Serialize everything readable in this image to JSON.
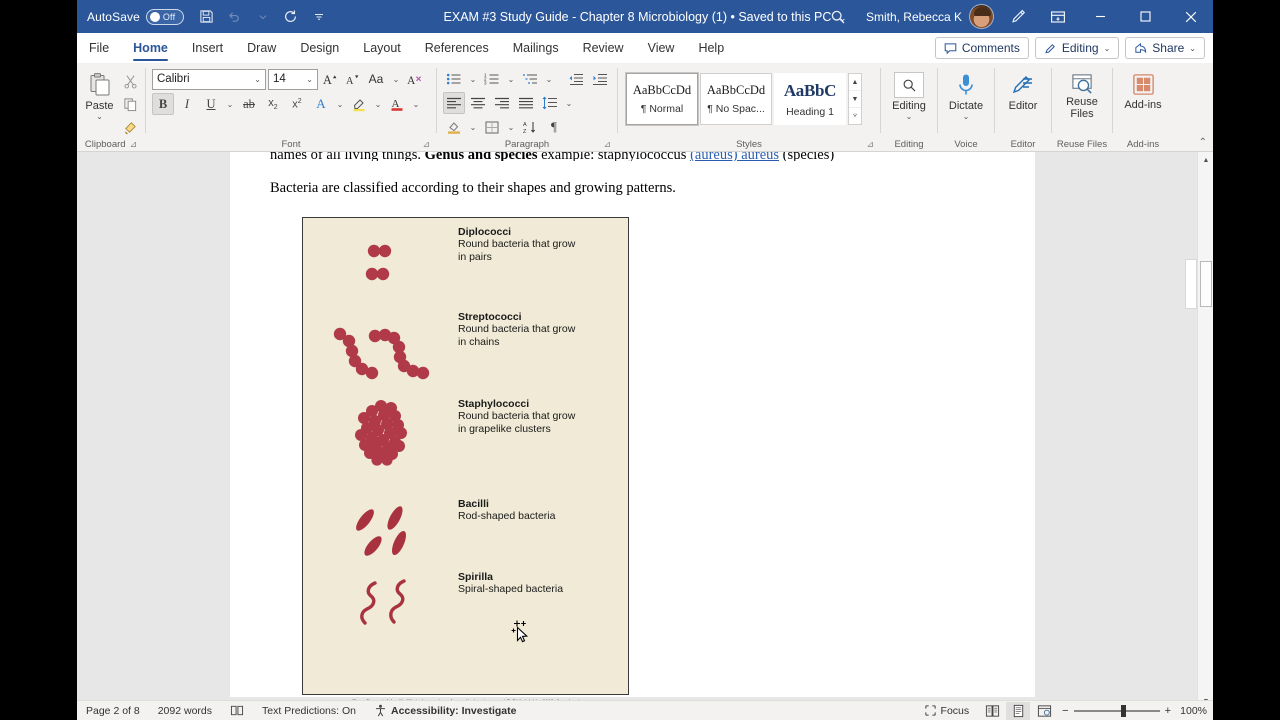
{
  "titlebar": {
    "autosave_label": "AutoSave",
    "autosave_state": "Off",
    "document_title": "EXAM #3 Study Guide - Chapter 8 Microbiology (1) • Saved to this PC",
    "account_name": "Smith, Rebecca K",
    "quick_access": [
      "save-icon",
      "undo-icon",
      "redo-icon",
      "customize-qat-icon"
    ],
    "right_icons": [
      "search-icon",
      "pen-icon",
      "ribbon-display-icon"
    ],
    "window_buttons": [
      "minimize",
      "maximize",
      "close"
    ],
    "accent_color": "#2b579a"
  },
  "tabs": [
    {
      "label": "File",
      "active": false
    },
    {
      "label": "Home",
      "active": true
    },
    {
      "label": "Insert",
      "active": false
    },
    {
      "label": "Draw",
      "active": false
    },
    {
      "label": "Design",
      "active": false
    },
    {
      "label": "Layout",
      "active": false
    },
    {
      "label": "References",
      "active": false
    },
    {
      "label": "Mailings",
      "active": false
    },
    {
      "label": "Review",
      "active": false
    },
    {
      "label": "View",
      "active": false
    },
    {
      "label": "Help",
      "active": false
    }
  ],
  "tabbar_actions": {
    "comments": "Comments",
    "editing": "Editing",
    "share": "Share"
  },
  "ribbon": {
    "clipboard": {
      "label": "Clipboard",
      "paste_label": "Paste",
      "buttons": [
        "cut-icon",
        "copy-icon",
        "format-painter-icon"
      ]
    },
    "font": {
      "label": "Font",
      "font_name": "Calibri",
      "font_size": "14",
      "buttons": [
        "grow-font-icon",
        "shrink-font-icon",
        "change-case-icon",
        "clear-formatting-icon",
        "bold-icon",
        "italic-icon",
        "underline-icon",
        "strikethrough-icon",
        "subscript-icon",
        "superscript-icon",
        "text-effects-icon",
        "text-highlight-icon",
        "font-color-icon"
      ]
    },
    "paragraph": {
      "label": "Paragraph",
      "buttons": [
        "bullets-icon",
        "numbering-icon",
        "multilevel-list-icon",
        "decrease-indent-icon",
        "increase-indent-icon",
        "align-left-icon",
        "align-center-icon",
        "align-right-icon",
        "justify-icon",
        "line-spacing-icon",
        "shading-icon",
        "borders-icon",
        "sort-icon",
        "show-marks-icon"
      ]
    },
    "styles": {
      "label": "Styles",
      "items": [
        {
          "sample": "AaBbCcDd",
          "name": "¶ Normal",
          "selected": true
        },
        {
          "sample": "AaBbCcDd",
          "name": "¶ No Spac...",
          "selected": false
        },
        {
          "sample": "AaBbC",
          "name": "Heading 1",
          "selected": false
        }
      ]
    },
    "editing": {
      "label": "Editing",
      "button_label": "Editing"
    },
    "voice": {
      "label": "Voice",
      "button_label": "Dictate"
    },
    "editor": {
      "label": "Editor",
      "button_label": "Editor"
    },
    "reuse_files": {
      "label": "Reuse Files",
      "button_label": "Reuse\nFiles",
      "line1": "Reuse",
      "line2": "Files"
    },
    "addins": {
      "label": "Add-ins",
      "button_label": "Add-ins"
    }
  },
  "document": {
    "clipped_line": {
      "prefix": "names of all living things. ",
      "bold": "Genus and species",
      "middle": " example: staphylococcus ",
      "link": "(aureus) aureus",
      "suffix": " (species)"
    },
    "paragraph": "Bacteria are classified according to their shapes and growing patterns.",
    "figure": {
      "caption": "(From Bonewit-West K: Clinical procedures for medical assistants, ed 7, Philadelphia, 2008, Saunders.)",
      "background_color": "#f0ead6",
      "organism_color": "#b03a48",
      "entries": [
        {
          "title": "Diplococci",
          "line1": "Round bacteria that grow",
          "line2": "in pairs",
          "shape": "pairs"
        },
        {
          "title": "Streptococci",
          "line1": "Round bacteria that grow",
          "line2": "in chains",
          "shape": "chains"
        },
        {
          "title": "Staphylococci",
          "line1": "Round bacteria that grow",
          "line2": "in grapelike clusters",
          "shape": "clusters"
        },
        {
          "title": "Bacilli",
          "line1": "Rod-shaped bacteria",
          "line2": "",
          "shape": "rods"
        },
        {
          "title": "Spirilla",
          "line1": "Spiral-shaped bacteria",
          "line2": "",
          "shape": "spirals"
        }
      ]
    }
  },
  "statusbar": {
    "page": "Page 2 of 8",
    "words": "2092 words",
    "proofing_icon": "proofing-icon",
    "text_predictions": "Text Predictions: On",
    "accessibility": "Accessibility: Investigate",
    "focus": "Focus",
    "views": [
      "read-mode-icon",
      "print-layout-icon",
      "web-layout-icon"
    ],
    "zoom_out": "−",
    "zoom_in": "+",
    "zoom_level": "100%"
  }
}
